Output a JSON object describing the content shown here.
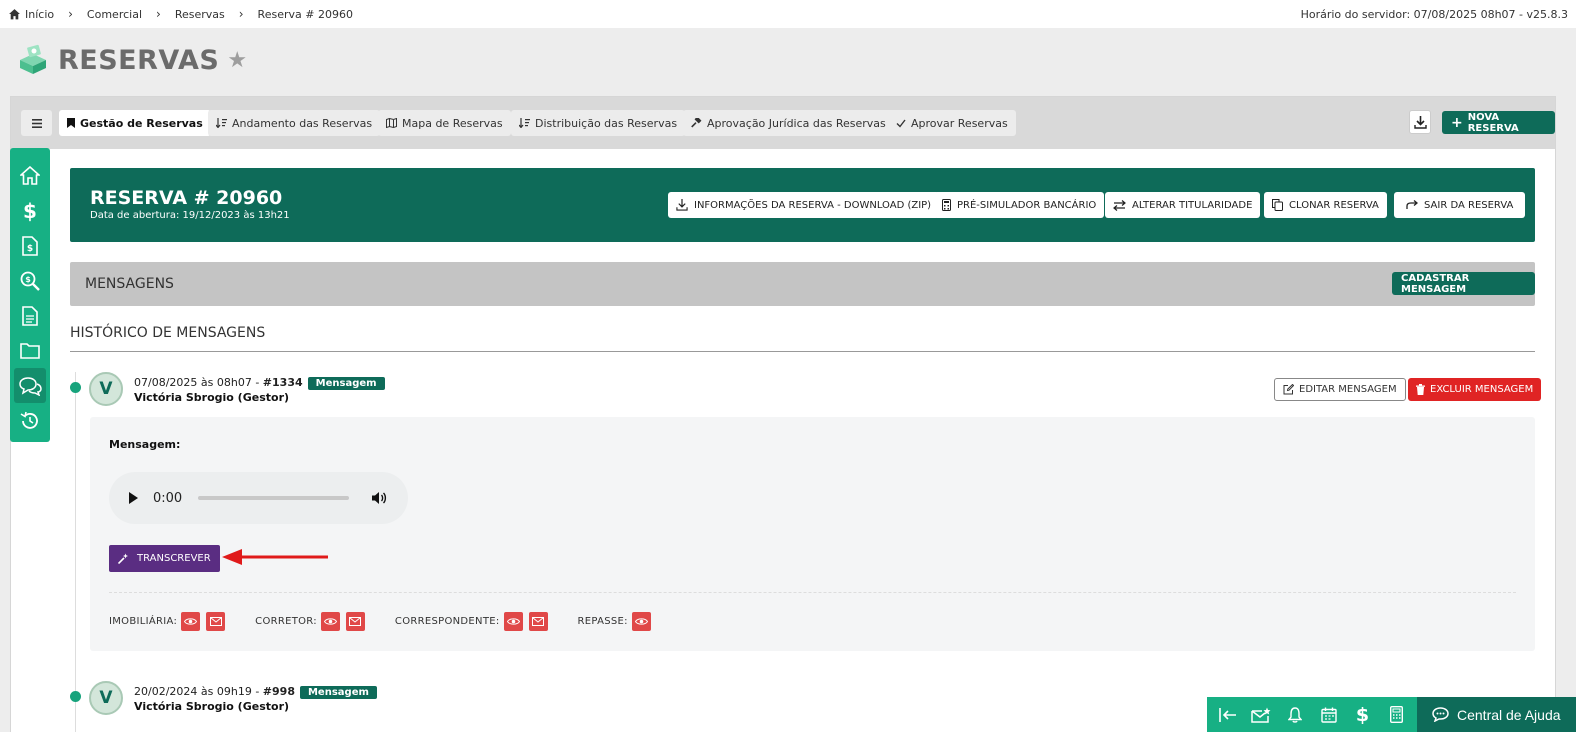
{
  "breadcrumb": {
    "items": [
      "Início",
      "Comercial",
      "Reservas",
      "Reserva # 20960"
    ]
  },
  "server_time": "Horário do servidor: 07/08/2025 08h07 - v25.8.3",
  "page": {
    "title": "RESERVAS"
  },
  "tabs": {
    "menu_icon": "hamburger-icon",
    "items": [
      {
        "label": "Gestão de Reservas",
        "icon": "bookmark-icon",
        "active": true
      },
      {
        "label": "Andamento das Reservas",
        "icon": "sort-desc-icon",
        "active": false
      },
      {
        "label": "Mapa de Reservas",
        "icon": "map-icon",
        "active": false
      },
      {
        "label": "Distribuição das Reservas",
        "icon": "sort-desc-icon",
        "active": false
      },
      {
        "label": "Aprovação Jurídica das Reservas",
        "icon": "gavel-icon",
        "active": false
      },
      {
        "label": "Aprovar Reservas",
        "icon": "check-icon",
        "active": false
      }
    ],
    "new_button": "NOVA RESERVA"
  },
  "sidebar": {
    "items": [
      "home-icon",
      "dollar-icon",
      "invoice-icon",
      "search-dollar-icon",
      "document-icon",
      "folder-icon",
      "chat-icon",
      "history-icon"
    ],
    "active": "chat-icon"
  },
  "reservation": {
    "title": "RESERVA # 20960",
    "opened": "Data de abertura: 19/12/2023 às 13h21",
    "buttons": {
      "download": "INFORMAÇÕES DA RESERVA - DOWNLOAD (ZIP)",
      "simulator": "PRÉ-SIMULADOR BANCÁRIO",
      "change_owner": "ALTERAR TITULARIDADE",
      "clone": "CLONAR RESERVA",
      "exit": "SAIR DA RESERVA"
    }
  },
  "messages": {
    "section_title": "MENSAGENS",
    "register_button": "CADASTRAR MENSAGEM",
    "history_title": "HISTÓRICO DE MENSAGENS",
    "items": [
      {
        "avatar": "V",
        "datetime": "07/08/2025 às 08h07 - ",
        "id": "#1334",
        "badge": "Mensagem",
        "author": "Victória Sbrogio (Gestor)"
      },
      {
        "avatar": "V",
        "datetime": "20/02/2024 às 09h19 - ",
        "id": "#998",
        "badge": "Mensagem",
        "author": "Victória Sbrogio (Gestor)"
      }
    ],
    "edit_button": "EDITAR MENSAGEM",
    "delete_button": "EXCLUIR MENSAGEM",
    "card": {
      "label": "Mensagem:",
      "audio_time": "0:00",
      "transcribe_button": "TRANSCREVER",
      "share": {
        "imobiliaria": "IMOBILIÁRIA:",
        "corretor": "CORRETOR:",
        "correspondente": "CORRESPONDENTE:",
        "repasse": "REPASSE:"
      }
    }
  },
  "bottom_bar": {
    "icons": [
      "collapse-left-icon",
      "mail-star-icon",
      "bell-icon",
      "calendar-icon",
      "dollar-icon",
      "calculator-icon"
    ],
    "help_label": "Central de Ajuda"
  },
  "colors": {
    "primary_dark": "#0e6b59",
    "primary_light": "#17b084",
    "danger": "#e02424",
    "transcribe": "#5a2d82"
  }
}
